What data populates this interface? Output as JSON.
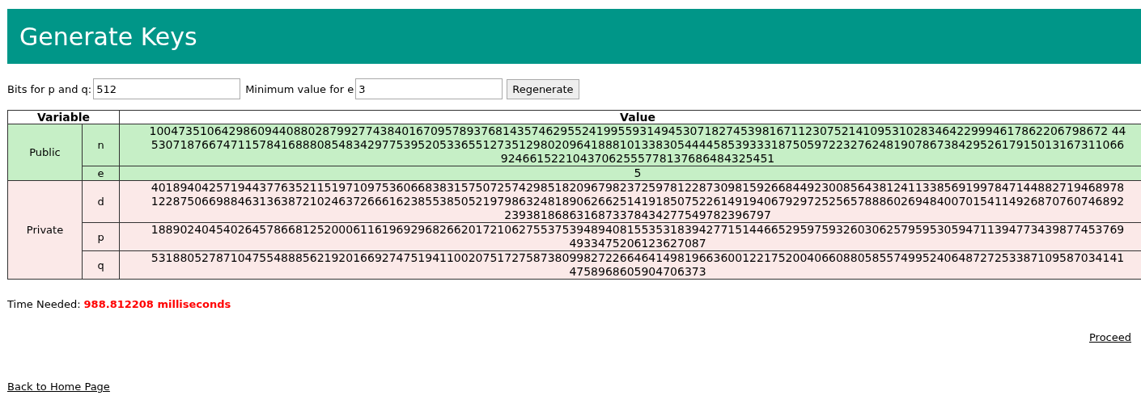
{
  "header": {
    "title": "Generate Keys"
  },
  "form": {
    "bits_label": "Bits for p and q:",
    "bits_value": "512",
    "e_label": "Minimum value for e",
    "e_value": "3",
    "button": "Regenerate"
  },
  "table": {
    "columns": [
      "Variable",
      "Value"
    ],
    "groups": [
      {
        "name": "Public",
        "kind": "public",
        "rows": [
          {
            "variable": "n",
            "lines": [
              "1004735106429860944088028799277438401670957893768143574629552419955931494530718274539816711230752141095310283464229994617862206798672 44",
              "530718766747115784168880854834297753952053365512735129802096418881013383054444585393331875059722327624819078673842952617915013167311066",
              "92466152210437062555778137686484325451"
            ]
          },
          {
            "variable": "e",
            "lines": [
              "5"
            ]
          }
        ]
      },
      {
        "name": "Private",
        "kind": "private",
        "rows": [
          {
            "variable": "d",
            "lines": [
              "401894042571944377635211519710975360668383157507257429851820967982372597812287309815926684492300856438124113385691997847144882719468978",
              "122875066988463136387210246372666162385538505219798632481890626625141918507522614919406792972525657888602694840070154114926870760746892",
              "2393818686316873378434277549782396797"
            ]
          },
          {
            "variable": "p",
            "lines": [
              "188902404540264578668125200061161969296826620172106275537539489408155353183942771514466529597593260306257959530594711394773439877453769",
              "4933475206123627087"
            ]
          },
          {
            "variable": "q",
            "lines": [
              "531880527871047554888562192016692747519411002075172758738099827226646414981966360012217520040660880585574995240648727253387109587034141",
              "4758968605904706373"
            ]
          }
        ]
      }
    ]
  },
  "time": {
    "label": "Time Needed:",
    "value": "988.812208 milliseconds"
  },
  "links": {
    "proceed": "Proceed",
    "back": "Back to Home Page"
  }
}
